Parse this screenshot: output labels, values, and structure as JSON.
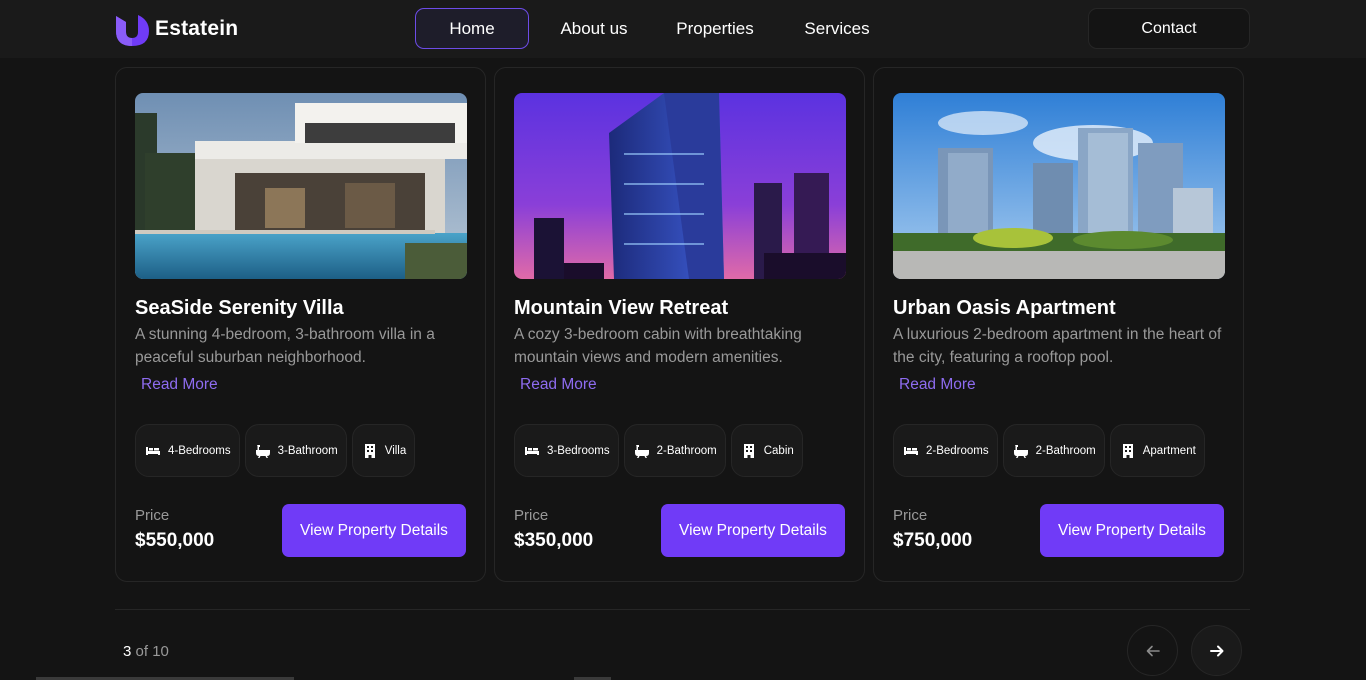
{
  "brand": {
    "name": "Estatein",
    "accent": "#703bf7"
  },
  "nav": {
    "home": "Home",
    "about": "About us",
    "properties": "Properties",
    "services": "Services",
    "contact": "Contact"
  },
  "properties": [
    {
      "title": "SeaSide Serenity Villa",
      "description": "A stunning 4-bedroom, 3-bathroom villa in a peaceful suburban neighborhood.",
      "read_more": "Read More",
      "tags": [
        {
          "icon": "bed-icon",
          "label": "4-Bedrooms"
        },
        {
          "icon": "bathtub-icon",
          "label": "3-Bathroom"
        },
        {
          "icon": "building-icon",
          "label": "Villa"
        }
      ],
      "price_label": "Price",
      "price": "$550,000",
      "button": "View Property Details"
    },
    {
      "title": "Mountain View Retreat",
      "description": "A cozy 3-bedroom cabin with breathtaking mountain views and modern amenities.",
      "read_more": "Read More",
      "tags": [
        {
          "icon": "bed-icon",
          "label": "3-Bedrooms"
        },
        {
          "icon": "bathtub-icon",
          "label": "2-Bathroom"
        },
        {
          "icon": "building-icon",
          "label": "Cabin"
        }
      ],
      "price_label": "Price",
      "price": "$350,000",
      "button": "View Property Details"
    },
    {
      "title": "Urban Oasis Apartment",
      "description": "A luxurious 2-bedroom apartment in the heart of the city, featuring a rooftop pool.",
      "read_more": "Read More",
      "tags": [
        {
          "icon": "bed-icon",
          "label": "2-Bedrooms"
        },
        {
          "icon": "bathtub-icon",
          "label": "2-Bathroom"
        },
        {
          "icon": "building-icon",
          "label": "Apartment"
        }
      ],
      "price_label": "Price",
      "price": "$750,000",
      "button": "View Property Details"
    }
  ],
  "pagination": {
    "current": "3",
    "total_text": " of 10"
  }
}
